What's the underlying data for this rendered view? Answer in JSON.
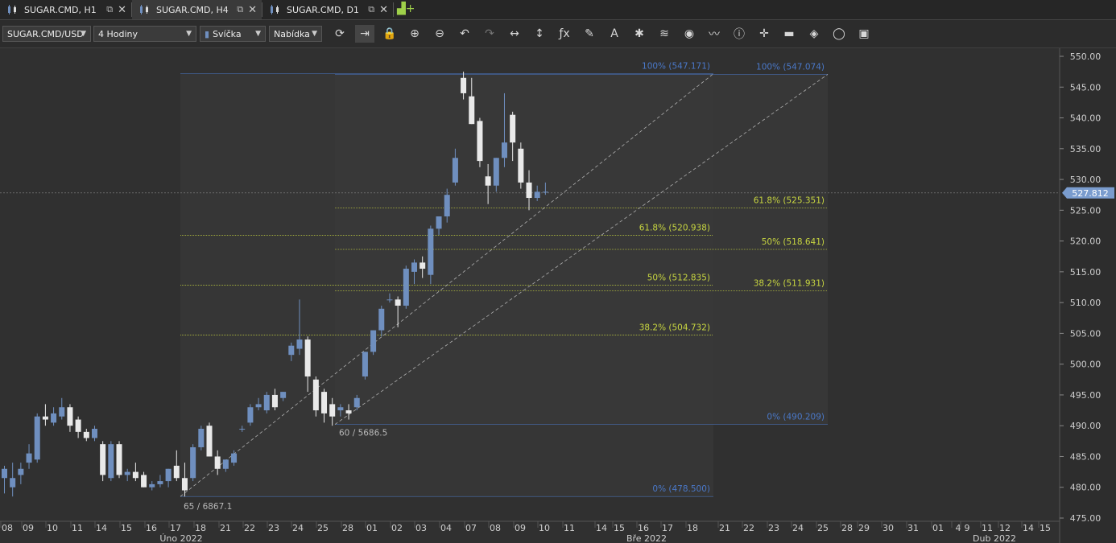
{
  "tabs": [
    {
      "label": "SUGAR.CMD, H1",
      "active": false
    },
    {
      "label": "SUGAR.CMD, H4",
      "active": true
    },
    {
      "label": "SUGAR.CMD, D1",
      "active": false
    }
  ],
  "toolbar": {
    "symbol": "SUGAR.CMD/USD",
    "timeframe": "4 Hodiny",
    "chart_type": "Svíčka",
    "menu": "Nabídka",
    "icons": [
      "refresh-icon",
      "shift-chart-icon",
      "lock-icon",
      "zoom-in-icon",
      "zoom-out-icon",
      "undo-icon",
      "redo-icon",
      "horizontal-arrows-icon",
      "vertical-arrows-icon",
      "function-icon",
      "pencil-icon",
      "text-icon",
      "sparkle-icon",
      "layers-icon",
      "eye-icon",
      "compare-chart-icon",
      "info-icon",
      "crosshair-icon",
      "color-strip-icon",
      "paint-bucket-icon",
      "settings-ring-icon",
      "save-icon"
    ]
  },
  "colors": {
    "bull": "#6f8fbf",
    "bear": "#e9e9e9",
    "fib_level": "#c8d640",
    "fib_edge": "#4a78c8",
    "current_price": "#7a9cce"
  },
  "chart_data": {
    "type": "candlestick",
    "y_axis": {
      "min": 475,
      "max": 550,
      "ticks": [
        "550.00",
        "545.00",
        "540.00",
        "535.00",
        "530.00",
        "525.00",
        "520.00",
        "515.00",
        "510.00",
        "505.00",
        "500.00",
        "495.00",
        "490.00",
        "485.00",
        "480.00",
        "475.00"
      ]
    },
    "current_price": {
      "value": 527.812,
      "label": "527.812"
    },
    "x_axis": {
      "day_labels": [
        "08",
        "09",
        "10",
        "11",
        "14",
        "15",
        "16",
        "17",
        "18",
        "21",
        "22",
        "23",
        "24",
        "25",
        "28",
        "01",
        "02",
        "03",
        "04",
        "07",
        "08",
        "09",
        "10",
        "11",
        "14",
        "15",
        "16",
        "17",
        "18",
        "21",
        "22",
        "23",
        "24",
        "25",
        "28",
        "29",
        "30",
        "31",
        "01",
        "4",
        "9",
        "11",
        "12",
        "14",
        "15"
      ],
      "month_labels": [
        "Úno 2022",
        "Bře 2022",
        "Dub 2022"
      ]
    },
    "candles": [
      {
        "o": 481.5,
        "h": 483.5,
        "l": 479,
        "c": 483
      },
      {
        "o": 480,
        "h": 484,
        "l": 478.5,
        "c": 481.5
      },
      {
        "o": 482,
        "h": 484,
        "l": 480.5,
        "c": 483
      },
      {
        "o": 484,
        "h": 487,
        "l": 483,
        "c": 485.5
      },
      {
        "o": 484.5,
        "h": 492,
        "l": 484,
        "c": 491.5
      },
      {
        "o": 491.5,
        "h": 493.5,
        "l": 490,
        "c": 491
      },
      {
        "o": 490.5,
        "h": 493,
        "l": 490,
        "c": 492
      },
      {
        "o": 491.5,
        "h": 494.5,
        "l": 491,
        "c": 493
      },
      {
        "o": 493,
        "h": 493.5,
        "l": 489,
        "c": 490
      },
      {
        "o": 491,
        "h": 491.5,
        "l": 488,
        "c": 489
      },
      {
        "o": 489,
        "h": 489.5,
        "l": 487.5,
        "c": 488
      },
      {
        "o": 488,
        "h": 490,
        "l": 487.5,
        "c": 489.5
      },
      {
        "o": 487,
        "h": 487.5,
        "l": 481,
        "c": 482
      },
      {
        "o": 481.5,
        "h": 487.5,
        "l": 481,
        "c": 487
      },
      {
        "o": 487,
        "h": 487.5,
        "l": 481.5,
        "c": 482
      },
      {
        "o": 482,
        "h": 483,
        "l": 481,
        "c": 482.5
      },
      {
        "o": 482.5,
        "h": 484,
        "l": 481,
        "c": 481.5
      },
      {
        "o": 482,
        "h": 482.5,
        "l": 480,
        "c": 480
      },
      {
        "o": 480,
        "h": 481,
        "l": 479.5,
        "c": 480.5
      },
      {
        "o": 480.5,
        "h": 482,
        "l": 480,
        "c": 481
      },
      {
        "o": 481,
        "h": 483,
        "l": 480,
        "c": 483
      },
      {
        "o": 483.5,
        "h": 486,
        "l": 481,
        "c": 481.5
      },
      {
        "o": 481.5,
        "h": 484,
        "l": 478.5,
        "c": 479.5
      },
      {
        "o": 481.5,
        "h": 487,
        "l": 481,
        "c": 486.5
      },
      {
        "o": 486.5,
        "h": 490,
        "l": 486,
        "c": 489.5
      },
      {
        "o": 490,
        "h": 490.5,
        "l": 485,
        "c": 485
      },
      {
        "o": 485,
        "h": 486,
        "l": 482,
        "c": 483
      },
      {
        "o": 483,
        "h": 484.5,
        "l": 482.5,
        "c": 484.5
      },
      {
        "o": 484,
        "h": 486,
        "l": 483.5,
        "c": 485.5
      },
      {
        "o": 489.5,
        "h": 490,
        "l": 489,
        "c": 489.5
      },
      {
        "o": 490.5,
        "h": 493.5,
        "l": 490,
        "c": 493
      },
      {
        "o": 493,
        "h": 494.5,
        "l": 492.5,
        "c": 493.5
      },
      {
        "o": 492.5,
        "h": 495.5,
        "l": 492,
        "c": 495
      },
      {
        "o": 495,
        "h": 496,
        "l": 492.5,
        "c": 493
      },
      {
        "o": 494.5,
        "h": 495.5,
        "l": 494,
        "c": 495.5
      },
      {
        "o": 501.5,
        "h": 503.5,
        "l": 500.5,
        "c": 503
      },
      {
        "o": 502.5,
        "h": 510.5,
        "l": 501.5,
        "c": 504
      },
      {
        "o": 504,
        "h": 504.5,
        "l": 495.5,
        "c": 498
      },
      {
        "o": 497.5,
        "h": 498,
        "l": 491.5,
        "c": 492.5
      },
      {
        "o": 495.5,
        "h": 496,
        "l": 490.5,
        "c": 492
      },
      {
        "o": 493.5,
        "h": 494.5,
        "l": 490,
        "c": 491.5
      },
      {
        "o": 492.5,
        "h": 493.5,
        "l": 491.5,
        "c": 493
      },
      {
        "o": 492.5,
        "h": 493.5,
        "l": 491,
        "c": 492
      },
      {
        "o": 493,
        "h": 495,
        "l": 492.5,
        "c": 494.5
      },
      {
        "o": 498,
        "h": 502,
        "l": 497.5,
        "c": 502
      },
      {
        "o": 502,
        "h": 505.5,
        "l": 501.5,
        "c": 505.5
      },
      {
        "o": 505.5,
        "h": 509.5,
        "l": 504.5,
        "c": 509
      },
      {
        "o": 510.5,
        "h": 511.5,
        "l": 510,
        "c": 510.5
      },
      {
        "o": 510.5,
        "h": 511,
        "l": 506,
        "c": 509.5
      },
      {
        "o": 509.5,
        "h": 516,
        "l": 509,
        "c": 515.5
      },
      {
        "o": 515,
        "h": 517,
        "l": 513,
        "c": 516.5
      },
      {
        "o": 516.5,
        "h": 517.5,
        "l": 514,
        "c": 515.5
      },
      {
        "o": 514.5,
        "h": 522.5,
        "l": 513,
        "c": 522
      },
      {
        "o": 522,
        "h": 524,
        "l": 521,
        "c": 524
      },
      {
        "o": 524,
        "h": 528.5,
        "l": 523,
        "c": 527.5
      },
      {
        "o": 529.5,
        "h": 535,
        "l": 529,
        "c": 533.5
      },
      {
        "o": 546.5,
        "h": 547.5,
        "l": 543,
        "c": 544
      },
      {
        "o": 543.5,
        "h": 546.5,
        "l": 539,
        "c": 539
      },
      {
        "o": 539.5,
        "h": 540,
        "l": 532,
        "c": 533
      },
      {
        "o": 530.5,
        "h": 532.5,
        "l": 526,
        "c": 529
      },
      {
        "o": 529,
        "h": 533.5,
        "l": 528,
        "c": 533.5
      },
      {
        "o": 533.5,
        "h": 544,
        "l": 532,
        "c": 536
      },
      {
        "o": 540.5,
        "h": 541,
        "l": 533,
        "c": 536
      },
      {
        "o": 535,
        "h": 536,
        "l": 528.5,
        "c": 529.5
      },
      {
        "o": 529.5,
        "h": 531.5,
        "l": 525,
        "c": 527
      },
      {
        "o": 527,
        "h": 529,
        "l": 526.5,
        "c": 528
      },
      {
        "o": 528,
        "h": 529.5,
        "l": 527.5,
        "c": 528
      }
    ],
    "fibonacci": [
      {
        "levels": [
          {
            "label": "100% (547.171)",
            "value": 547.171
          },
          {
            "label": "61.8% (520.938)",
            "value": 520.938
          },
          {
            "label": "50% (512.835)",
            "value": 512.835
          },
          {
            "label": "38.2% (504.732)",
            "value": 504.732
          },
          {
            "label": "0% (478.500)",
            "value": 478.5
          }
        ],
        "anchor_label": "65 / 6867.1"
      },
      {
        "levels": [
          {
            "label": "100% (547.074)",
            "value": 547.074
          },
          {
            "label": "61.8% (525.351)",
            "value": 525.351
          },
          {
            "label": "50% (518.641)",
            "value": 518.641
          },
          {
            "label": "38.2% (511.931)",
            "value": 511.931
          },
          {
            "label": "0% (490.209)",
            "value": 490.209
          }
        ],
        "anchor_label": "60 / 5686.5"
      }
    ]
  }
}
